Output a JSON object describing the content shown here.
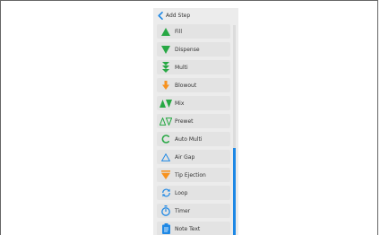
{
  "header": {
    "title": "Add Step"
  },
  "colors": {
    "green": "#27a844",
    "orange": "#f7921e",
    "blue": "#1e88e5",
    "accent_scroll": "#1e88e5"
  },
  "steps": [
    {
      "label": "Fill",
      "icon": "triangle-up-icon"
    },
    {
      "label": "Dispense",
      "icon": "triangle-down-icon"
    },
    {
      "label": "Multi",
      "icon": "multi-dispense-icon"
    },
    {
      "label": "Blowout",
      "icon": "arrow-down-icon"
    },
    {
      "label": "Mix",
      "icon": "mix-icon"
    },
    {
      "label": "Prewet",
      "icon": "prewet-icon"
    },
    {
      "label": "Auto Multi",
      "icon": "auto-multi-icon"
    },
    {
      "label": "Air Gap",
      "icon": "air-gap-icon"
    },
    {
      "label": "Tip Ejection",
      "icon": "tip-ejection-icon"
    },
    {
      "label": "Loop",
      "icon": "loop-icon"
    },
    {
      "label": "Timer",
      "icon": "timer-icon"
    },
    {
      "label": "Note Text",
      "icon": "note-text-icon"
    }
  ]
}
